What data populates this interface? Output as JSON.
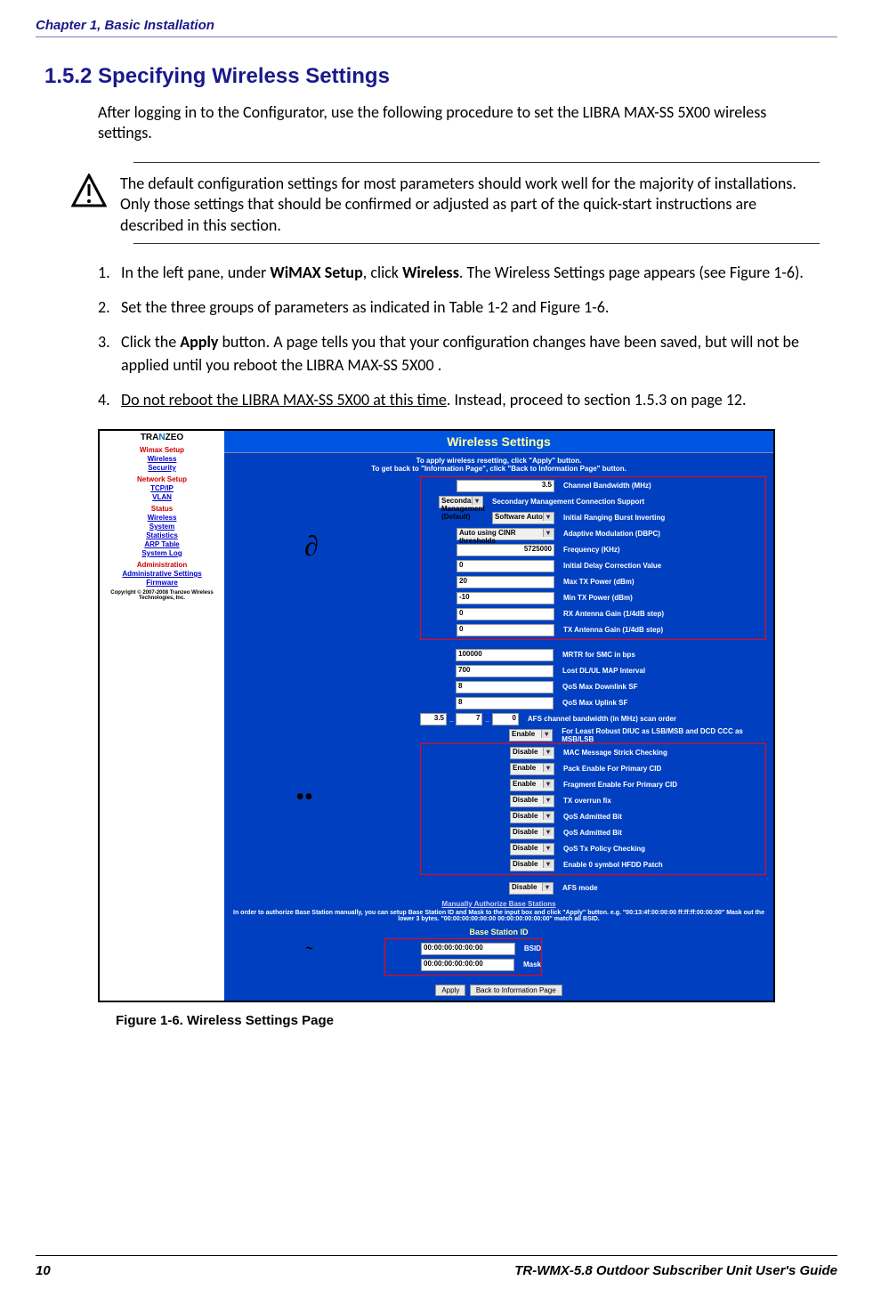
{
  "header": "Chapter 1, Basic Installation",
  "section_heading": "1.5.2 Specifying Wireless Settings",
  "intro": "After logging in to the Configurator, use the following procedure to set the LIBRA MAX-SS 5X00  wireless settings.",
  "note": "The default configuration settings for most parameters should work well for the majority of installations. Only those settings that should be confirmed or adjusted as part of the quick-start instructions are described in this section.",
  "steps": {
    "s1a": "In the left pane, under ",
    "s1b": "WiMAX Setup",
    "s1c": ", click ",
    "s1d": "Wireless",
    "s1e": ". The Wireless Settings page appears (see Figure 1-6).",
    "s2": "Set the three groups of parameters as indicated in Table 1-2 and Figure 1-6.",
    "s3a": "Click the ",
    "s3b": "Apply",
    "s3c": " button. A page tells you that your configuration changes have been saved, but will not be applied until you reboot the LIBRA MAX-SS 5X00 .",
    "s4a": "Do not reboot the LIBRA MAX-SS 5X00  at this time",
    "s4b": ". Instead, proceed to section 1.5.3 on page 12."
  },
  "nums": {
    "n1": "1.",
    "n2": "2.",
    "n3": "3.",
    "n4": "4."
  },
  "screenshot": {
    "logo": "TRANZEO",
    "sidebar": {
      "wimax": "Wimax Setup",
      "wireless": "Wireless",
      "security": "Security",
      "network": "Network Setup",
      "tcpip": "TCP/IP",
      "vlan": "VLAN",
      "status": "Status",
      "wireless2": "Wireless",
      "system": "System",
      "statistics": "Statistics",
      "arp": "ARP Table",
      "syslog": "System Log",
      "admin": "Administration",
      "adminset": "Administrative Settings",
      "firmware": "Firmware",
      "copyright": "Copyright © 2007-2008 Tranzeo Wireless Technologies, Inc."
    },
    "title": "Wireless Settings",
    "subtitle1": "To apply wireless resetting, click \"Apply\" button.",
    "subtitle2": "To get back to \"Information Page\", click \"Back to Information Page\" button.",
    "group1": {
      "chbw_val": "3.5",
      "chbw_lbl": "Channel Bandwidth (MHz)",
      "secmg_val": "Secondary Management (Default)",
      "secmg_lbl": "Secondary Management Connection Support",
      "rang_val": "Software Auto",
      "rang_lbl": "Initial Ranging Burst Inverting",
      "adapt_val": "Auto using CINR thresholds",
      "adapt_lbl": "Adaptive Modulation (DBPC)",
      "freq_val": "5725000",
      "freq_lbl": "Frequency (KHz)",
      "delay_val": "0",
      "delay_lbl": "Initial Delay Correction Value",
      "maxtx_val": "20",
      "maxtx_lbl": "Max TX Power (dBm)",
      "mintx_val": "-10",
      "mintx_lbl": "Min TX Power (dBm)",
      "rxant_val": "0",
      "rxant_lbl": "RX Antenna Gain (1/4dB step)",
      "txant_val": "0",
      "txant_lbl": "TX Antenna Gain (1/4dB step)"
    },
    "middle": {
      "mrtr_val": "100000",
      "mrtr_lbl": "MRTR for SMC in bps",
      "lost_val": "700",
      "lost_lbl": "Lost DL/UL MAP Interval",
      "qdl_val": "8",
      "qdl_lbl": "QoS Max Downlink SF",
      "qul_val": "8",
      "qul_lbl": "QoS Max Uplink SF",
      "afs1": "3.5",
      "afs2": "7",
      "afs3": "0",
      "afs_lbl": "AFS channel bandwidth (in MHz) scan order",
      "least_val": "Enable",
      "least_lbl": "For Least Robust DIUC as LSB/MSB and DCD CCC as MSB/LSB"
    },
    "group2": {
      "mac_val": "Disable",
      "mac_lbl": "MAC Message Strick Checking",
      "pack_val": "Enable",
      "pack_lbl": "Pack Enable For Primary CID",
      "frag_val": "Enable",
      "frag_lbl": "Fragment Enable For Primary CID",
      "txov_val": "Disable",
      "txov_lbl": "TX overrun fix",
      "qadm_val": "Disable",
      "qadm_lbl": "QoS Admitted Bit",
      "qadm2_val": "Disable",
      "qadm2_lbl": "QoS Admitted Bit",
      "qtx_val": "Disable",
      "qtx_lbl": "QoS Tx Policy Checking",
      "en0_val": "Disable",
      "en0_lbl": "Enable 0 symbol HFDD Patch"
    },
    "afsmode_val": "Disable",
    "afsmode_lbl": "AFS mode",
    "manual_link": "Manually Authorize Base Stations",
    "disclaimer": "In order to authorize Base Station manually, you can setup Base Station ID and Mask to the input box and click \"Apply\" button. e.g. \"00:13:4f:00:00:00 ff:ff:ff:00:00:00\" Mask out the lower 3 bytes. \"00:00:00:00:00:00 00:00:00:00:00:00\" match all BSID.",
    "bs_title": "Base Station ID",
    "bsid_val": "00:00:00:00:00:00",
    "bsid_lbl": "BSID",
    "mask_val": "00:00:00:00:00:00",
    "mask_lbl": "Mask",
    "apply_btn": "Apply",
    "back_btn": "Back to Information Page",
    "annot1": "∂",
    "annot2": "••",
    "annot3": "˜"
  },
  "figure_caption": "Figure 1-6. Wireless Settings Page",
  "footer": {
    "page": "10",
    "title": "TR-WMX-5.8 Outdoor Subscriber Unit User's Guide"
  }
}
